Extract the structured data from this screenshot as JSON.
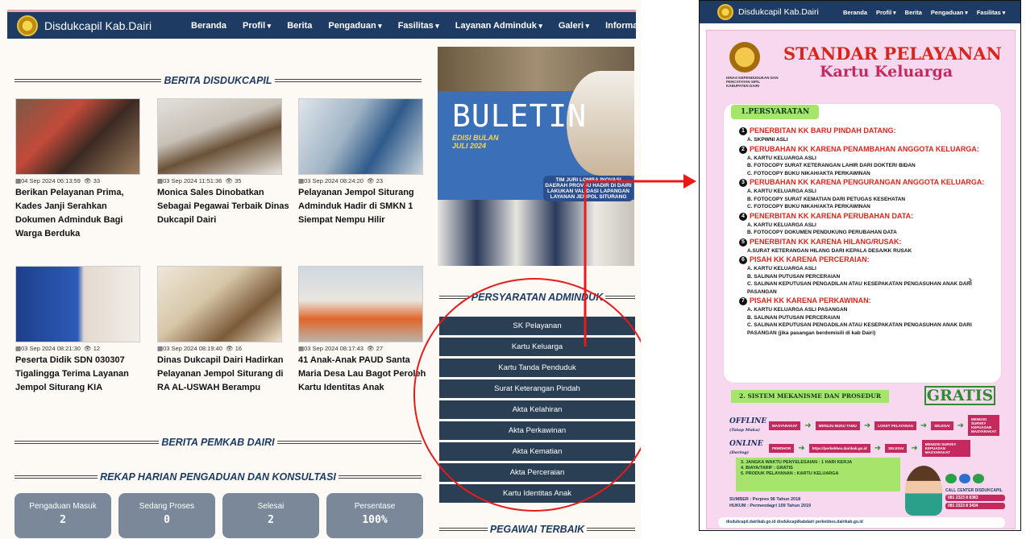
{
  "navbar": {
    "brand": "Disdukcapil Kab.Dairi",
    "items": [
      "Beranda",
      "Profil",
      "Berita",
      "Pengaduan",
      "Fasilitas",
      "Layanan Adminduk",
      "Galeri",
      "Informasi"
    ]
  },
  "sections": {
    "berita": "BERITA DISDUKCAPIL",
    "pemkab": "BERITA PEMKAB DAIRI",
    "rekap": "REKAP HARIAN PENGADUAN DAN KONSULTASI",
    "persyaratan": "PERSYARATAN ADMINDUK",
    "pegawai": "PEGAWAI TERBAIK"
  },
  "news": [
    {
      "date": "04 Sep 2024 06:13:59",
      "views": "33",
      "title": "Berikan Pelayanan Prima, Kades Janji Serahkan Dokumen Adminduk Bagi Warga Berduka"
    },
    {
      "date": "03 Sep 2024 11:51:36",
      "views": "35",
      "title": "Monica Sales Dinobatkan Sebagai Pegawai Terbaik Dinas Dukcapil Dairi"
    },
    {
      "date": "03 Sep 2024 08:24:20",
      "views": "23",
      "title": "Pelayanan Jempol Siturang Adminduk Hadir di SMKN 1 Siempat Nempu Hilir"
    },
    {
      "date": "03 Sep 2024 08:21:30",
      "views": "12",
      "title": "Peserta Didik SDN 030307 Tigalingga Terima Layanan Jempol Siturang KIA"
    },
    {
      "date": "03 Sep 2024 08:19:40",
      "views": "16",
      "title": "Dinas Dukcapil Dairi Hadirkan Pelayanan Jempol Siturang di RA AL-USWAH Berampu"
    },
    {
      "date": "03 Sep 2024 08:17:43",
      "views": "27",
      "title": "41 Anak-Anak PAUD Santa Maria Desa Lau Bagot Peroleh Kartu Identitas Anak"
    }
  ],
  "stats": [
    {
      "label": "Pengaduan Masuk",
      "value": "2"
    },
    {
      "label": "Sedang Proses",
      "value": "0"
    },
    {
      "label": "Selesai",
      "value": "2"
    },
    {
      "label": "Persentase",
      "value": "100%"
    }
  ],
  "buletin": {
    "title": "BULETIN",
    "subtitle": "EDISI BULAN JULI 2024",
    "caption": "TIM JURI LOMBA INOVASI DAERAH PROVSU HADIR DI DAIRI LAKUKAN VALIDASI LAPANGAN LAYANAN JEMPOL SITURANG"
  },
  "adminduk": [
    "SK Pelayanan",
    "Kartu Keluarga",
    "Kartu Tanda Penduduk",
    "Surat Keterangan Pindah",
    "Akta Kelahiran",
    "Akta Perkawinan",
    "Akta Kematian",
    "Akta Perceraian",
    "Kartu Identitas Anak"
  ],
  "right": {
    "brand": "Disdukcapil Kab.Dairi",
    "items": [
      "Beranda",
      "Profil",
      "Berita",
      "Pengaduan",
      "Fasilitas"
    ]
  },
  "poster": {
    "dept": "DINAS KEPENDUDUKAN DAN PENCATATAN SIPIL KABUPATEN DAIRI",
    "title1": "STANDAR PELAYANAN",
    "title2": "Kartu Keluarga",
    "section1": "1.PERSYARATAN",
    "reqs": [
      {
        "n": "1",
        "h": "PENERBITAN KK BARU PINDAH DATANG:",
        "s": [
          "A. SKPWNI ASLI"
        ]
      },
      {
        "n": "2",
        "h": "PERUBAHAN KK KARENA PENAMBAHAN ANGGOTA KELUARGA:",
        "s": [
          "A. KARTU KELUARGA ASLI",
          "B. FOTOCOPY SURAT KETERANGAN LAHIR DARI DOKTER/ BIDAN",
          "C. FOTOCOPY BUKU NIKAH/AKTA PERKAWINAN"
        ]
      },
      {
        "n": "3",
        "h": "PERUBAHAN KK KARENA PENGURANGAN ANGGOTA KELUARGA:",
        "s": [
          "A. KARTU KELUARGA ASLI",
          "B. FOTOCOPY SURAT KEMATIAN DARI PETUGAS KESEHATAN",
          "C. FOTOCOPY BUKU NIKAH/AKTA PERKAWINAN"
        ]
      },
      {
        "n": "4",
        "h": "PENERBITAN KK KARENA PERUBAHAN DATA:",
        "s": [
          "A. KARTU KELUARGA ASLI",
          "B. FOTOCOPY DOKUMEN PENDUKUNG PERUBAHAN DATA"
        ]
      },
      {
        "n": "5",
        "h": "PENERBITAN KK KARENA HILANG/RUSAK:",
        "s": [
          "A.SURAT KETERANGAN HILANG DARI KEPALA DESA/KK RUSAK"
        ]
      },
      {
        "n": "6",
        "h": "PISAH KK KARENA PERCERAIAN:",
        "s": [
          "A. KARTU KELUARGA ASLI",
          "B. SALINAN PUTUSAN PERCERAIAN",
          "C. SALINAN KEPUTUSAN PENGADILAN ATAU KESEPAKATAN PENGASUHAN ANAK DARI PASANGAN"
        ]
      },
      {
        "n": "7",
        "h": "PISAH KK KARENA PERKAWINAN:",
        "s": [
          "A. KARTU KELUARGA ASLI PASANGAN",
          "B. SALINAN PUTUSAN PERCERAIAN",
          "C. SALINAN KEPUTUSAN PENGADILAN ATAU KESEPAKATAN PENGASUHAN ANAK DARI PASANGAN (jika pasangan berdomisili di kab Dairi)"
        ]
      }
    ],
    "section2": "2. SISTEM MEKANISME DAN PROSEDUR",
    "gratis": "GRATIS",
    "offline": {
      "mode": "OFFLINE",
      "sub": "(Tatap Muka)",
      "steps": [
        "MASYARAKAT",
        "MENUJU BUKU TAMU",
        "LOKET PELAYANAN",
        "SELESAI",
        "MENGISI SURVEY KEPUASAN MASYARAKAT"
      ]
    },
    "online": {
      "mode": "ONLINE",
      "sub": "(Daring)",
      "steps": [
        "PEMOHON",
        "https://perkebbes.dairikab.go.id",
        "SELESAI",
        "MENGISI SURVEY KEPUASAN MASYARAKAT"
      ]
    },
    "info": [
      "3. JANGKA WAKTU PENYELESAIAN : 1 HARI KERJA",
      "4. BIAYA/TARIF : GRATIS",
      "5. PRODUK PELAYANAN : KARTU KELUARGA"
    ],
    "callcenter": "CALL CENTER DISDUKCAPIL",
    "phones": [
      "081 2323 8 8383",
      "081 2323 8 3434"
    ],
    "sumber": "SUMBER : Perpres 96 Tahun 2018",
    "hukum": "HUKUM : Permendagri 109 Tahun 2019",
    "footer": "disdukcapil.dairikab.go.id     disdukcapilkabdairi     perkebbes.dairikab.go.id"
  }
}
